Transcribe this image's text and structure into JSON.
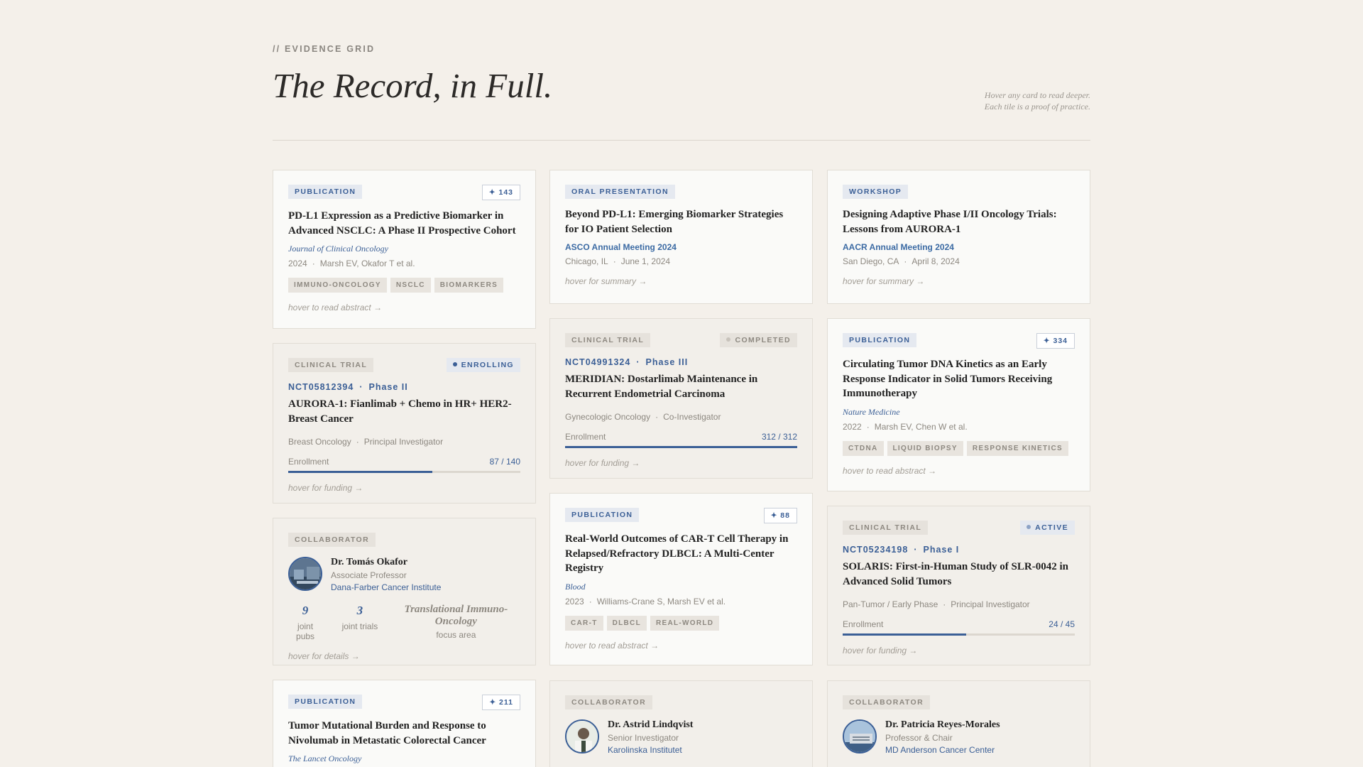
{
  "header": {
    "eyebrow": "// EVIDENCE GRID",
    "title": "The Record, in Full.",
    "hint_line1": "Hover any card to read deeper.",
    "hint_line2": "Each tile is a proof of practice."
  },
  "colors": {
    "accent": "#3b5f96",
    "background": "#f4f0ea",
    "muted": "#8d8880"
  },
  "cards": {
    "c1": {
      "tag": "PUBLICATION",
      "count": "✦ 143",
      "title": "PD-L1 Expression as a Predictive Biomarker in Advanced NSCLC: A Phase II Prospective Cohort",
      "journal": "Journal of Clinical Oncology",
      "year": "2024",
      "authors": "Marsh EV, Okafor T et al.",
      "keywords": [
        "IMMUNO-ONCOLOGY",
        "NSCLC",
        "BIOMARKERS"
      ],
      "hover": "hover to read abstract →"
    },
    "c2": {
      "tag": "CLINICAL TRIAL",
      "status": "ENROLLING",
      "id": "NCT05812394",
      "phase": "Phase II",
      "title": "AURORA-1: Fianlimab + Chemo in HR+ HER2- Breast Cancer",
      "area": "Breast Oncology",
      "role": "Principal Investigator",
      "enroll_label": "Enrollment",
      "enroll_value": "87 / 140",
      "enroll_fraction": 0.621,
      "hover": "hover for funding →"
    },
    "c3": {
      "tag": "COLLABORATOR",
      "name": "Dr. Tomás Okafor",
      "role": "Associate Professor",
      "institution": "Dana-Farber Cancer Institute",
      "pubs": "9",
      "pubs_label": "joint pubs",
      "trials": "3",
      "trials_label": "joint trials",
      "focus": "Translational Immuno-Oncology",
      "focus_label": "focus area",
      "hover": "hover for details →"
    },
    "c4": {
      "tag": "PUBLICATION",
      "count": "✦ 211",
      "title": "Tumor Mutational Burden and Response to Nivolumab in Metastatic Colorectal Cancer",
      "journal": "The Lancet Oncology"
    },
    "c5": {
      "tag": "ORAL PRESENTATION",
      "title": "Beyond PD-L1: Emerging Biomarker Strategies for IO Patient Selection",
      "venue": "ASCO Annual Meeting 2024",
      "place": "Chicago, IL",
      "date": "June 1, 2024",
      "hover": "hover for summary →"
    },
    "c6": {
      "tag": "CLINICAL TRIAL",
      "status": "COMPLETED",
      "id": "NCT04991324",
      "phase": "Phase III",
      "title": "MERIDIAN: Dostarlimab Maintenance in Recurrent Endometrial Carcinoma",
      "area": "Gynecologic Oncology",
      "role": "Co-Investigator",
      "enroll_label": "Enrollment",
      "enroll_value": "312 / 312",
      "enroll_fraction": 1.0,
      "hover": "hover for funding →"
    },
    "c7": {
      "tag": "PUBLICATION",
      "count": "✦ 88",
      "title": "Real-World Outcomes of CAR-T Cell Therapy in Relapsed/Refractory DLBCL: A Multi-Center Registry",
      "journal": "Blood",
      "year": "2023",
      "authors": "Williams-Crane S, Marsh EV et al.",
      "keywords": [
        "CAR-T",
        "DLBCL",
        "REAL-WORLD"
      ],
      "hover": "hover to read abstract →"
    },
    "c8": {
      "tag": "COLLABORATOR",
      "name": "Dr. Astrid Lindqvist",
      "role": "Senior Investigator",
      "institution": "Karolinska Institutet"
    },
    "c9": {
      "tag": "WORKSHOP",
      "title": "Designing Adaptive Phase I/II Oncology Trials: Lessons from AURORA-1",
      "venue": "AACR Annual Meeting 2024",
      "place": "San Diego, CA",
      "date": "April 8, 2024",
      "hover": "hover for summary →"
    },
    "c10": {
      "tag": "PUBLICATION",
      "count": "✦ 334",
      "title": "Circulating Tumor DNA Kinetics as an Early Response Indicator in Solid Tumors Receiving Immunotherapy",
      "journal": "Nature Medicine",
      "year": "2022",
      "authors": "Marsh EV, Chen W et al.",
      "keywords": [
        "CTDNA",
        "LIQUID BIOPSY",
        "RESPONSE KINETICS"
      ],
      "hover": "hover to read abstract →"
    },
    "c11": {
      "tag": "CLINICAL TRIAL",
      "status": "ACTIVE",
      "id": "NCT05234198",
      "phase": "Phase I",
      "title": "SOLARIS: First-in-Human Study of SLR-0042 in Advanced Solid Tumors",
      "area": "Pan-Tumor / Early Phase",
      "role": "Principal Investigator",
      "enroll_label": "Enrollment",
      "enroll_value": "24 / 45",
      "enroll_fraction": 0.533,
      "hover": "hover for funding →"
    },
    "c12": {
      "tag": "COLLABORATOR",
      "name": "Dr. Patricia Reyes-Morales",
      "role": "Professor & Chair",
      "institution": "MD Anderson Cancer Center"
    }
  }
}
